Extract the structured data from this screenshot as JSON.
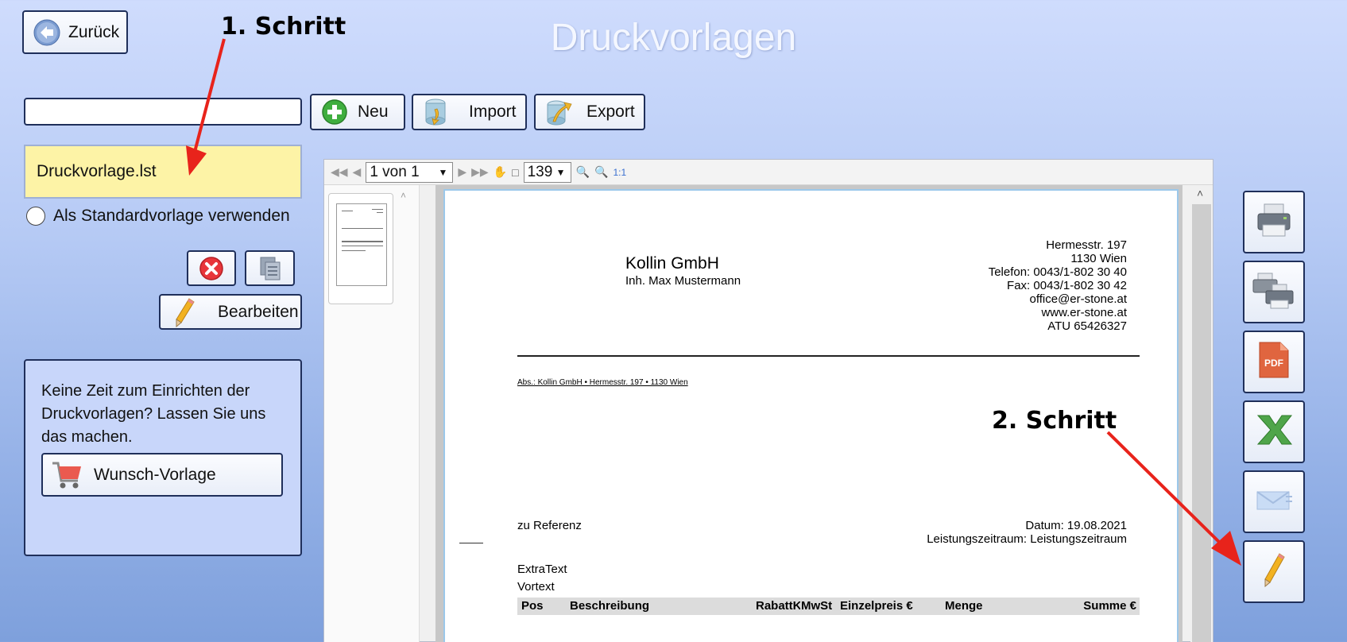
{
  "header": {
    "title": "Druckvorlagen",
    "back_label": "Zurück"
  },
  "annotations": {
    "step1": "1. Schritt",
    "step2": "2. Schritt"
  },
  "toolbar": {
    "search_value": "",
    "new_label": "Neu",
    "import_label": "Import",
    "export_label": "Export"
  },
  "templates": {
    "items": [
      "Druckvorlage.lst"
    ],
    "use_default_label": "Als Standardvorlage verwenden",
    "use_default_checked": false,
    "edit_label": "Bearbeiten"
  },
  "promo": {
    "text": "Keine Zeit zum Einrichten der Druckvorlagen? Lassen Sie uns das machen.",
    "button_label": "Wunsch-Vorlage"
  },
  "preview": {
    "page_select": "1 von 1",
    "zoom": "139",
    "one_to_one": "1:1",
    "document": {
      "company": "Kollin GmbH",
      "owner": "Inh. Max Mustermann",
      "address_lines": [
        "Hermesstr. 197",
        "1130 Wien",
        "Telefon: 0043/1-802 30 40",
        "Fax: 0043/1-802 30 42",
        "office@er-stone.at",
        "www.er-stone.at",
        "ATU 65426327"
      ],
      "sender_line": "Abs.: Kollin GmbH • Hermesstr. 197 • 1130 Wien",
      "reference": "zu Referenz",
      "date_line": "Datum: 19.08.2021",
      "period_line": "Leistungszeitraum: Leistungszeitraum",
      "extra_text": "ExtraText",
      "pre_text": "Vortext",
      "table_headers": [
        "Pos",
        "Beschreibung",
        "RabattKo",
        "MwSt",
        "Einzelpreis €",
        "Menge",
        "Summe €"
      ]
    }
  },
  "colors": {
    "accent_red": "#e8231b",
    "selected_item": "#fdf3a6",
    "border": "#1f2f5a"
  }
}
